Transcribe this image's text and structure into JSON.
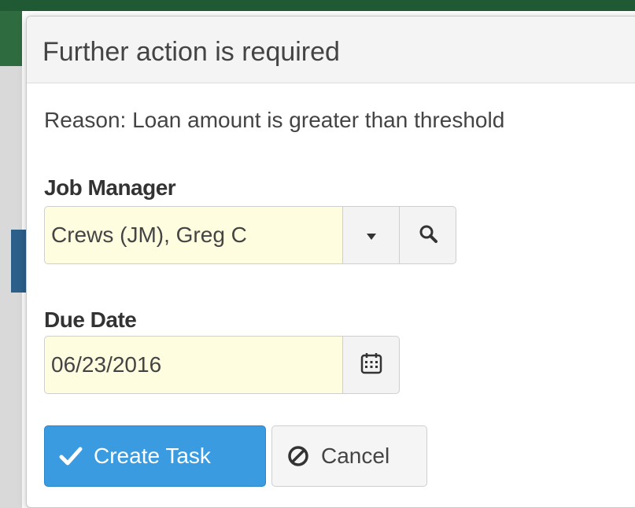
{
  "dialog": {
    "title": "Further action is required",
    "reason": "Reason: Loan amount is greater than threshold"
  },
  "job_manager": {
    "label": "Job Manager",
    "value": "Crews (JM), Greg C",
    "dropdown_icon": "caret-down-icon",
    "search_icon": "search-icon"
  },
  "due_date": {
    "label": "Due Date",
    "value": "06/23/2016",
    "calendar_icon": "calendar-icon"
  },
  "actions": {
    "create_label": "Create Task",
    "cancel_label": "Cancel"
  },
  "colors": {
    "primary": "#3a9be0",
    "input_bg": "#fffde0",
    "header_bg": "#f4f4f4",
    "topbar": "#1f5a34"
  }
}
